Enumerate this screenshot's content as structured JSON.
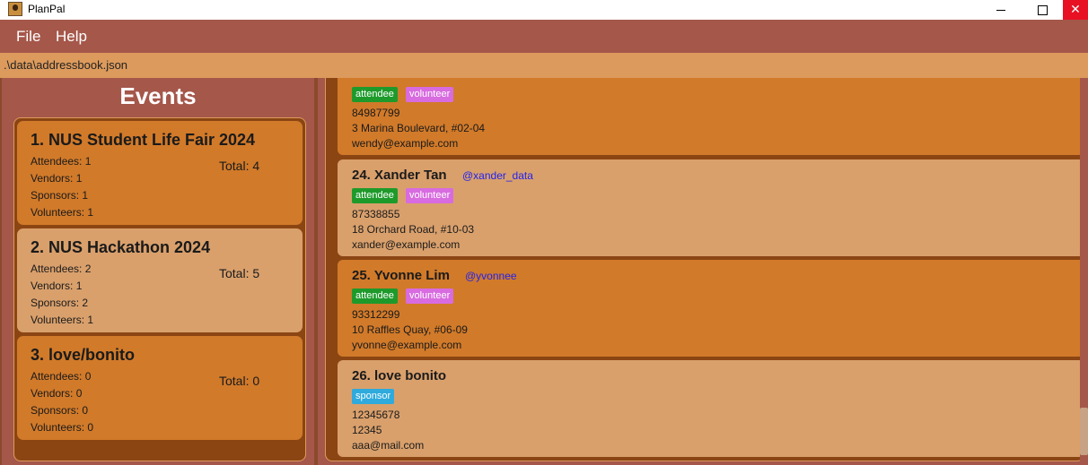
{
  "window": {
    "title": "PlanPal",
    "min_glyph": "–",
    "max_glyph": "☐",
    "close_glyph": "✕"
  },
  "menu": {
    "file": "File",
    "help": "Help"
  },
  "path": ".\\data\\addressbook.json",
  "events": {
    "heading": "Events",
    "items": [
      {
        "name": "1. NUS Student Life Fair 2024",
        "attendees": "Attendees: 1",
        "vendors": "Vendors: 1",
        "sponsors": "Sponsors: 1",
        "volunteers": "Volunteers: 1",
        "total": "Total: 4"
      },
      {
        "name": "2. NUS Hackathon 2024",
        "attendees": "Attendees: 2",
        "vendors": "Vendors: 1",
        "sponsors": "Sponsors: 2",
        "volunteers": "Volunteers: 1",
        "total": "Total: 5"
      },
      {
        "name": "3. love/bonito",
        "attendees": "Attendees: 0",
        "vendors": "Vendors: 0",
        "sponsors": "Sponsors: 0",
        "volunteers": "Volunteers: 0",
        "total": "Total: 0"
      }
    ]
  },
  "contacts": [
    {
      "name": "",
      "handle": "",
      "tags": [
        "attendee",
        "volunteer"
      ],
      "phone": "84987799",
      "address": "3 Marina Boulevard, #02-04",
      "email": "wendy@example.com"
    },
    {
      "name": "24. Xander Tan",
      "handle": "@xander_data",
      "tags": [
        "attendee",
        "volunteer"
      ],
      "phone": "87338855",
      "address": "18 Orchard Road, #10-03",
      "email": "xander@example.com"
    },
    {
      "name": "25. Yvonne Lim",
      "handle": "@yvonnee",
      "tags": [
        "attendee",
        "volunteer"
      ],
      "phone": "93312299",
      "address": "10 Raffles Quay, #06-09",
      "email": "yvonne@example.com"
    },
    {
      "name": "26. love bonito",
      "handle": "",
      "tags": [
        "sponsor"
      ],
      "phone": "12345678",
      "address": "12345",
      "email": "aaa@mail.com"
    }
  ],
  "colors": {
    "menu_bg": "#a5574a",
    "path_bg": "#dc9a5c",
    "card_dark": "#d17a2a",
    "card_light": "#d9a06c",
    "tag_attendee": "#1e9a2b",
    "tag_volunteer": "#d86be0",
    "tag_sponsor": "#2eaadc",
    "handle": "#2222ee"
  }
}
